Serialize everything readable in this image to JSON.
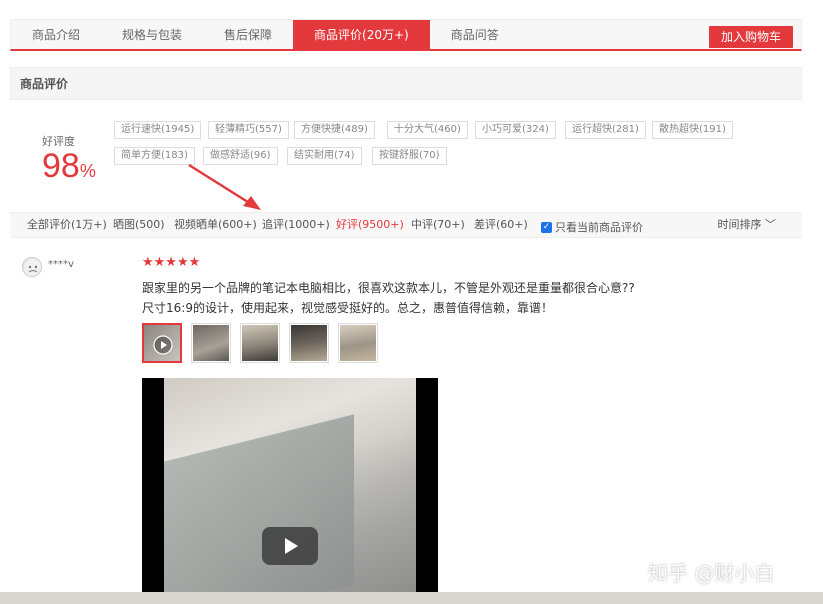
{
  "tabs": [
    {
      "label": "商品介绍"
    },
    {
      "label": "规格与包装"
    },
    {
      "label": "售后保障"
    },
    {
      "label": "商品评价(20万+)"
    },
    {
      "label": "商品问答"
    }
  ],
  "cart_button": "加入购物车",
  "section_title": "商品评价",
  "rating": {
    "label": "好评度",
    "value": "98",
    "unit": "%"
  },
  "tags": [
    "运行速快(1945)",
    "轻薄精巧(557)",
    "方便快捷(489)",
    "十分大气(460)",
    "小巧可爱(324)",
    "运行超快(281)",
    "散热超快(191)",
    "简单方便(183)",
    "做感舒适(96)",
    "结实耐用(74)",
    "按键舒服(70)"
  ],
  "filters": [
    {
      "label": "全部评价(1万+)"
    },
    {
      "label": "晒图(500)"
    },
    {
      "label": "视频晒单(600+)"
    },
    {
      "label": "追评(1000+)"
    },
    {
      "label": "好评(9500+)"
    },
    {
      "label": "中评(70+)"
    },
    {
      "label": "差评(60+)"
    }
  ],
  "only_current_label": "只看当前商品评价",
  "sort_label": "时间排序",
  "review": {
    "username": "****v",
    "stars": "★★★★★",
    "line1": "跟家里的另一个品牌的笔记本电脑相比，很喜欢这款本儿，不管是外观还是重量都很合心意??",
    "line2": "尺寸16:9的设计，使用起来，视觉感受挺好的。总之，惠普值得信赖，靠谱！"
  },
  "watermark": "知乎 @财小白",
  "colors": {
    "accent": "#e4393c",
    "checkbox": "#1a73e8"
  },
  "icons": {
    "play": "play-icon",
    "checkbox": "check-icon",
    "sort": "chevron-down-icon",
    "arrow": "annotation-arrow-icon"
  }
}
